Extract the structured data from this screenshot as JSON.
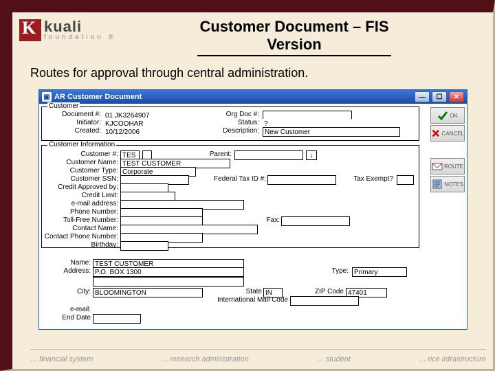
{
  "slide": {
    "title_line1": "Customer  Document – FIS",
    "title_line2": "Version",
    "subtitle": "Routes for approval through central administration."
  },
  "logo": {
    "word": "kuali",
    "sub": "foundation",
    "reg": "®"
  },
  "window": {
    "title": "AR Customer Document",
    "doc": {
      "legend": "Customer",
      "labels": {
        "docnum": "Document #:",
        "initiator": "Initiator:",
        "created": "Created:",
        "orgdoc": "Org Doc #:",
        "status": "Status:",
        "description": "Description:"
      },
      "values": {
        "docnum": "01   JK3264907",
        "initiator": "KJCOOHAR",
        "created": "10/12/2006",
        "status": "?",
        "description": "New Customer"
      }
    },
    "cust": {
      "legend": "Customer Information",
      "labels": {
        "custnum": "Customer #:",
        "custname": "Customer Name:",
        "custtype": "Customer Type:",
        "custssn": "Customer SSN:",
        "creditapp": "Credit Approved by:",
        "creditlimit": "Credit Limit:",
        "email": "e-mail address:",
        "phone": "Phone Number:",
        "tollfree": "Toll-Free Number:",
        "contact": "Contact Name:",
        "contactphone": "Contact Phone Number:",
        "birthday": "Birthday:",
        "parent": "Parent:",
        "fedtax": "Federal Tax ID #:",
        "taxexempt": "Tax Exempt?",
        "fax": "Fax:"
      },
      "values": {
        "custnum_a": "TES",
        "custnum_b": "",
        "custname": "TEST CUSTOMER",
        "custtype": "Corporate"
      }
    },
    "addr": {
      "labels": {
        "name": "Name:",
        "address": "Address:",
        "city": "City:",
        "state": "State",
        "zip": "ZIP Code",
        "intl": "International Mail Code",
        "email2": "e-mail:",
        "enddate": "End Date",
        "type": "Type:"
      },
      "values": {
        "name": "TEST CUSTOMER",
        "address": "P.O. BOX 1300",
        "city": "BLOOMINGTON",
        "state": "IN",
        "zip": "47401",
        "type": "Primary"
      }
    },
    "buttons": {
      "ok": "OK",
      "cancel": "CANCEL",
      "route": "ROUTE",
      "notes": "NOTES"
    }
  },
  "footer": {
    "a": "financial system",
    "b": "research administration",
    "c": "student",
    "d": "rice infrastructure"
  }
}
